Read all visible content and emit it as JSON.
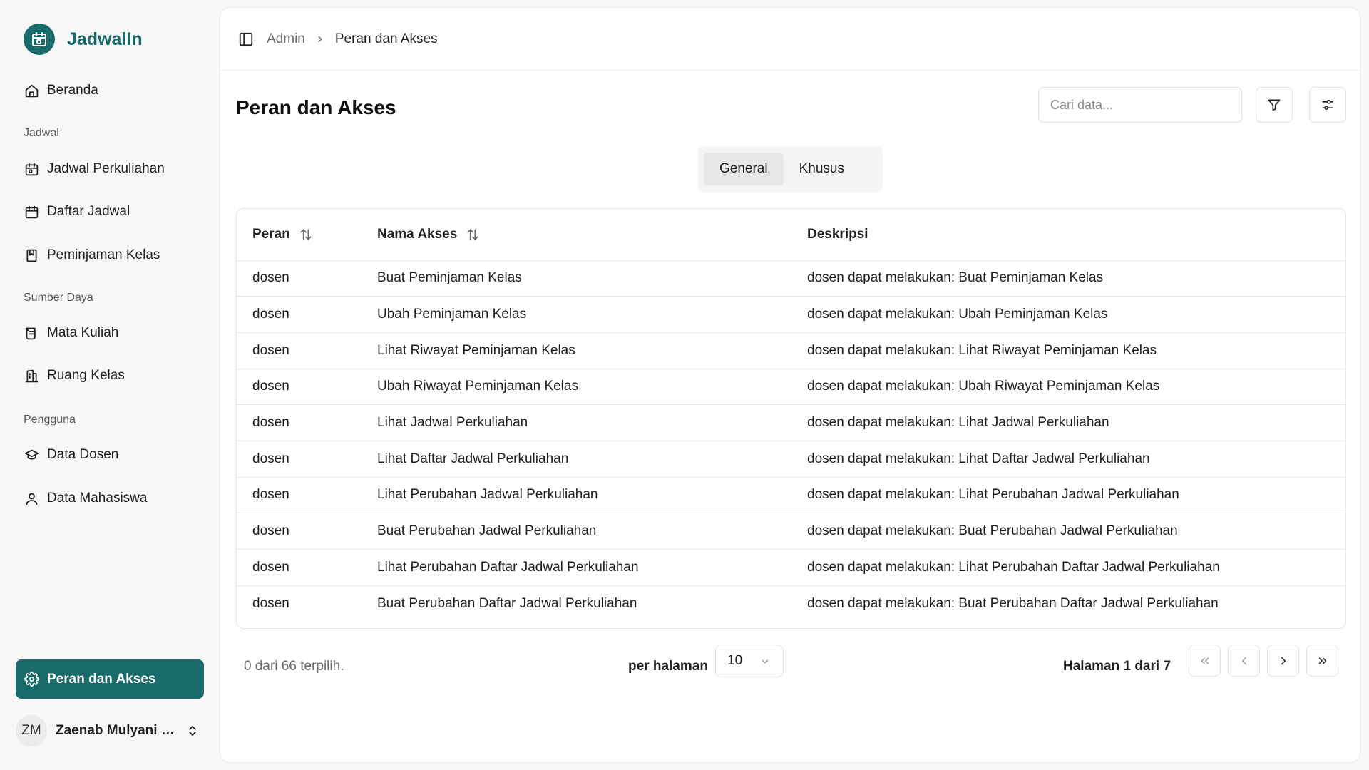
{
  "app": {
    "name": "JadwalIn"
  },
  "sidebar": {
    "home": "Beranda",
    "groups": [
      {
        "label": "Jadwal",
        "items": [
          "Jadwal Perkuliahan",
          "Daftar Jadwal",
          "Peminjaman Kelas"
        ]
      },
      {
        "label": "Sumber Daya",
        "items": [
          "Mata Kuliah",
          "Ruang Kelas"
        ]
      },
      {
        "label": "Pengguna",
        "items": [
          "Data Dosen",
          "Data Mahasiswa"
        ]
      }
    ],
    "active_item": "Peran dan Akses",
    "user": {
      "initials": "ZM",
      "name": "Zaenab Mulyani M..."
    }
  },
  "breadcrumb": {
    "parent": "Admin",
    "current": "Peran dan Akses"
  },
  "page": {
    "title": "Peran dan Akses"
  },
  "search": {
    "placeholder": "Cari data..."
  },
  "tabs": [
    {
      "label": "General",
      "active": true
    },
    {
      "label": "Khusus",
      "active": false
    }
  ],
  "table": {
    "headers": [
      "Peran",
      "Nama Akses",
      "Deskripsi"
    ],
    "rows": [
      [
        "dosen",
        "Buat Peminjaman Kelas",
        "dosen dapat melakukan: Buat Peminjaman Kelas"
      ],
      [
        "dosen",
        "Ubah Peminjaman Kelas",
        "dosen dapat melakukan: Ubah Peminjaman Kelas"
      ],
      [
        "dosen",
        "Lihat Riwayat Peminjaman Kelas",
        "dosen dapat melakukan: Lihat Riwayat Peminjaman Kelas"
      ],
      [
        "dosen",
        "Ubah Riwayat Peminjaman Kelas",
        "dosen dapat melakukan: Ubah Riwayat Peminjaman Kelas"
      ],
      [
        "dosen",
        "Lihat Jadwal Perkuliahan",
        "dosen dapat melakukan: Lihat Jadwal Perkuliahan"
      ],
      [
        "dosen",
        "Lihat Daftar Jadwal Perkuliahan",
        "dosen dapat melakukan: Lihat Daftar Jadwal Perkuliahan"
      ],
      [
        "dosen",
        "Lihat Perubahan Jadwal Perkuliahan",
        "dosen dapat melakukan: Lihat Perubahan Jadwal Perkuliahan"
      ],
      [
        "dosen",
        "Buat Perubahan Jadwal Perkuliahan",
        "dosen dapat melakukan: Buat Perubahan Jadwal Perkuliahan"
      ],
      [
        "dosen",
        "Lihat Perubahan Daftar Jadwal Perkuliahan",
        "dosen dapat melakukan: Lihat Perubahan Daftar Jadwal Perkuliahan"
      ],
      [
        "dosen",
        "Buat Perubahan Daftar Jadwal Perkuliahan",
        "dosen dapat melakukan: Buat Perubahan Daftar Jadwal Perkuliahan"
      ]
    ]
  },
  "footer": {
    "selection": "0 dari 66 terpilih.",
    "per_page_label": "per halaman",
    "per_page_value": "10",
    "page_info": "Halaman 1 dari 7"
  },
  "colors": {
    "brand": "#1a6b6b",
    "border": "#e5e5e5",
    "muted_text": "#6b6b6b"
  },
  "icons": {
    "brand": "calendar-icon",
    "home": "home-icon",
    "jadwal-perkuliahan": "calendar-icon",
    "daftar-jadwal": "calendar-icon",
    "peminjaman-kelas": "book-icon",
    "mata-kuliah": "scroll-icon",
    "ruang-kelas": "building-icon",
    "data-dosen": "graduation-cap-icon",
    "data-mahasiswa": "user-icon",
    "peran-dan-akses": "gear-icon",
    "sidebar-toggle": "panel-left-icon",
    "filter": "filter-icon",
    "settings": "sliders-icon"
  }
}
